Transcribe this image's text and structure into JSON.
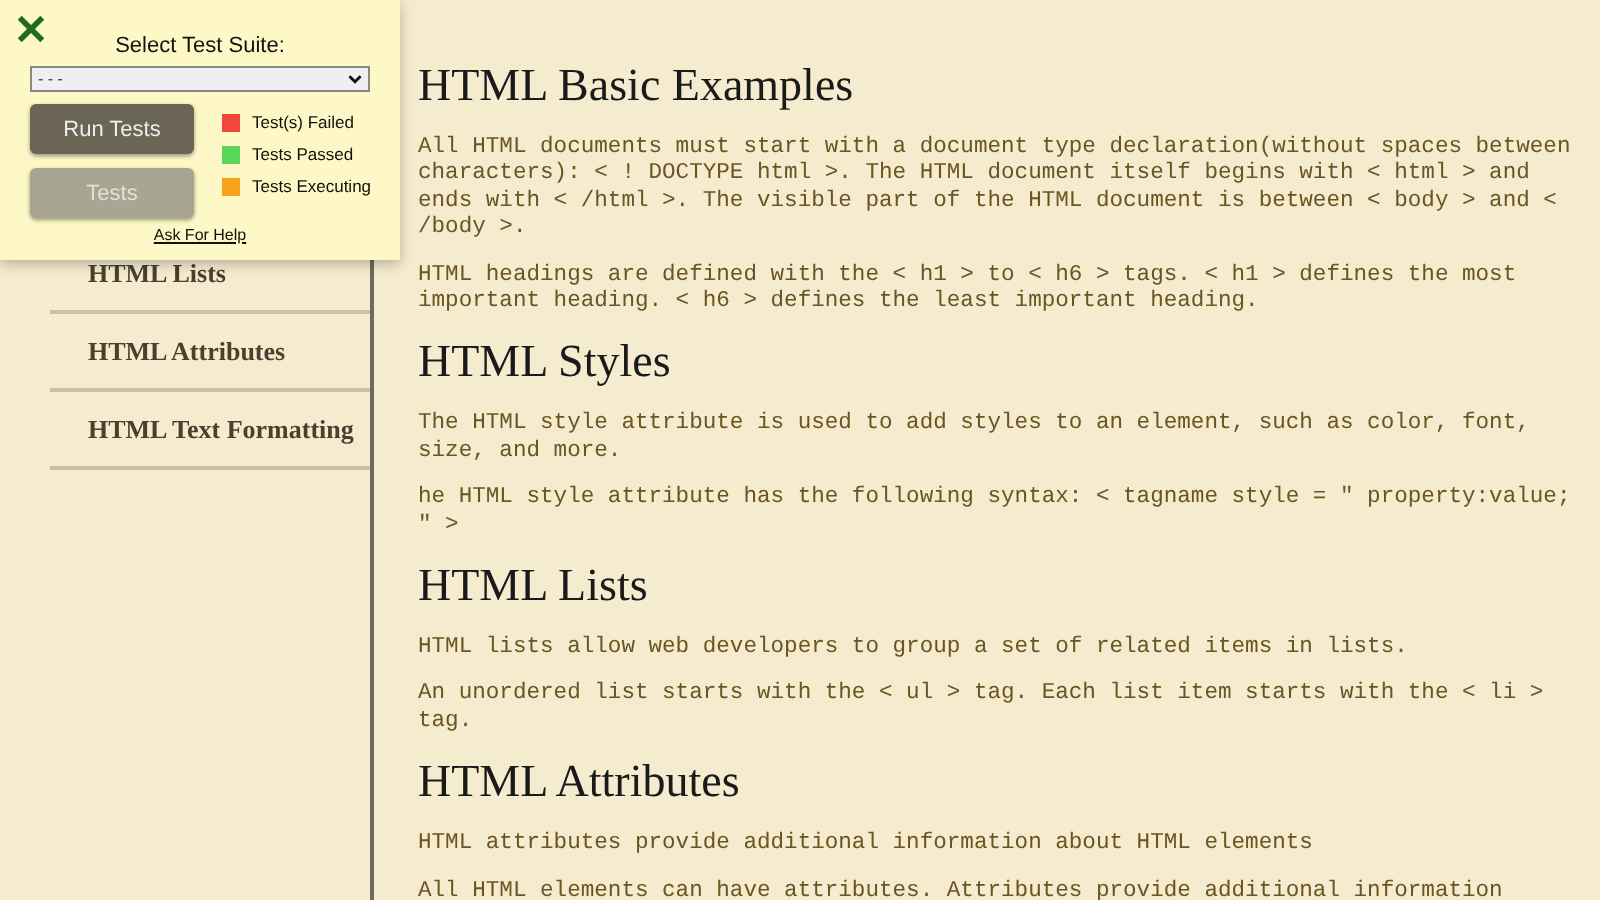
{
  "overlay": {
    "title": "Select Test Suite:",
    "suite_select": {
      "value": "- - -"
    },
    "buttons": [
      {
        "label": "Run Tests",
        "disabled": false
      },
      {
        "label": "Tests",
        "disabled": true
      }
    ],
    "legend": [
      {
        "label": "Test(s) Failed",
        "color": "#f0463c"
      },
      {
        "label": "Tests Passed",
        "color": "#5cd65c"
      },
      {
        "label": "Tests Executing",
        "color": "#f5a31a"
      }
    ],
    "help_link": "Ask For Help"
  },
  "sidebar": {
    "items": [
      "HTML Lists",
      "HTML Attributes",
      "HTML Text Formatting"
    ]
  },
  "content": {
    "sections": [
      {
        "heading": "HTML Basic Examples",
        "paragraphs": [
          "All HTML documents must start with a document type declaration(without spaces between characters): < ! DOCTYPE html >. The HTML document itself begins with < html > and ends with < /html >. The visible part of the HTML document is between < body > and < /body >.",
          "HTML headings are defined with the < h1 > to < h6 > tags. < h1 > defines the most important heading. < h6 > defines the least important heading."
        ]
      },
      {
        "heading": "HTML Styles",
        "paragraphs": [
          "The HTML style attribute is used to add styles to an element, such as color, font, size, and more.",
          "he HTML style attribute has the following syntax: < tagname style = \" property:value; \" >"
        ]
      },
      {
        "heading": "HTML Lists",
        "paragraphs": [
          "HTML lists allow web developers to group a set of related items in lists.",
          "An unordered list starts with the < ul > tag. Each list item starts with the < li > tag."
        ]
      },
      {
        "heading": "HTML Attributes",
        "paragraphs": [
          "HTML attributes provide additional information about HTML elements",
          "All HTML elements can have attributes. Attributes provide additional information"
        ]
      }
    ]
  }
}
